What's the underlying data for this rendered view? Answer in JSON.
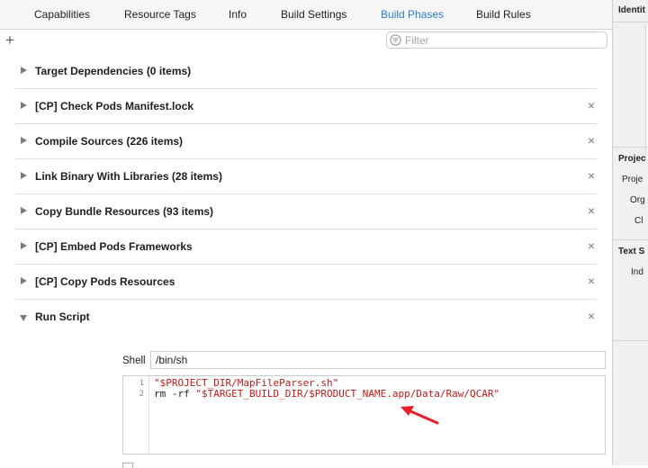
{
  "tabs": [
    {
      "label": "Capabilities",
      "active": false
    },
    {
      "label": "Resource Tags",
      "active": false
    },
    {
      "label": "Info",
      "active": false
    },
    {
      "label": "Build Settings",
      "active": false
    },
    {
      "label": "Build Phases",
      "active": true
    },
    {
      "label": "Build Rules",
      "active": false
    }
  ],
  "toolbar": {
    "add_label": "+",
    "filter_placeholder": "Filter"
  },
  "phases": [
    {
      "title": "Target Dependencies (0 items)",
      "expanded": false,
      "removable": false
    },
    {
      "title": "[CP] Check Pods Manifest.lock",
      "expanded": false,
      "removable": true
    },
    {
      "title": "Compile Sources (226 items)",
      "expanded": false,
      "removable": true
    },
    {
      "title": "Link Binary With Libraries (28 items)",
      "expanded": false,
      "removable": true
    },
    {
      "title": "Copy Bundle Resources (93 items)",
      "expanded": false,
      "removable": true
    },
    {
      "title": "[CP] Embed Pods Frameworks",
      "expanded": false,
      "removable": true
    },
    {
      "title": "[CP] Copy Pods Resources",
      "expanded": false,
      "removable": true
    },
    {
      "title": "Run Script",
      "expanded": true,
      "removable": true
    }
  ],
  "close_glyph": "×",
  "run_script": {
    "shell_label": "Shell",
    "shell_value": "/bin/sh",
    "lines": [
      {
        "number": "1",
        "plain": "",
        "string": "\"$PROJECT_DIR/MapFileParser.sh\""
      },
      {
        "number": "2",
        "plain": "rm -rf ",
        "string": "\"$TARGET_BUILD_DIR/$PRODUCT_NAME.app/Data/Raw/QCAR\""
      }
    ]
  },
  "annotation": {
    "arrow_color": "#e8202a"
  },
  "inspector": {
    "identity_header": "Identit",
    "project_header": "Projec",
    "project_label": "Proje",
    "org_label": "Org",
    "class_label": "Cl",
    "text_header": "Text S",
    "indent_label": "Ind"
  },
  "colors": {
    "accent": "#2a7fd4",
    "string": "#c41a16"
  }
}
